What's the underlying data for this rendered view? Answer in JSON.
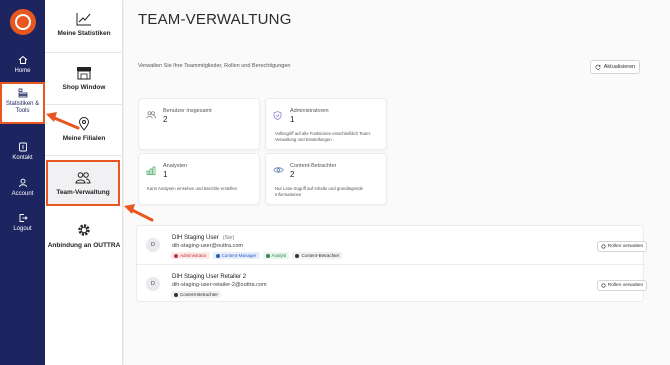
{
  "rail": {
    "items": [
      {
        "label": "Home",
        "icon": "home-icon"
      },
      {
        "label": "Statistiken & Tools",
        "icon": "chart-tools-icon"
      },
      {
        "label": "Kontakt",
        "icon": "contact-icon"
      },
      {
        "label": "Account",
        "icon": "user-icon"
      },
      {
        "label": "Logout",
        "icon": "logout-icon"
      }
    ]
  },
  "subnav": {
    "items": [
      {
        "label": "Meine Statistiken",
        "icon": "line-chart-icon"
      },
      {
        "label": "Shop Window",
        "icon": "storefront-icon"
      },
      {
        "label": "Meine Filialen",
        "icon": "map-pin-icon"
      },
      {
        "label": "Team-Verwaltung",
        "icon": "team-icon"
      },
      {
        "label": "Anbindung an OUTTRA",
        "icon": "gear-icon"
      }
    ]
  },
  "page": {
    "title": "TEAM-VERWALTUNG",
    "subtitle": "Verwalten Sie Ihre Teammitglieder, Rollen und Berechtigungen",
    "refresh_label": "Aktualisieren"
  },
  "cards": [
    {
      "label": "Benutzer insgesamt",
      "value": "2",
      "desc": "",
      "icon": "users-icon"
    },
    {
      "label": "Administratoren",
      "value": "1",
      "desc": "Vollzugriff auf alle Funktionen einschließlich Team-Verwaltung und Einstellungen",
      "icon": "shield-icon"
    },
    {
      "label": "Analysten",
      "value": "1",
      "desc": "Kann Analysen einsehen und Berichte erstellen",
      "icon": "bar-chart-icon"
    },
    {
      "label": "Content-Betrachter",
      "value": "2",
      "desc": "Nur Lese-Zugriff auf Inhalte und grundlegende Informationen",
      "icon": "eye-icon"
    }
  ],
  "users": [
    {
      "initial": "D",
      "name": "DIH Staging User",
      "you": "(Sie)",
      "email": "dih-staging-user@outtra.com",
      "tags": [
        "Administrator",
        "Content-Manager",
        "Analyst",
        "Content-Betrachter"
      ],
      "manage_label": "Rollen verwalten"
    },
    {
      "initial": "D",
      "name": "DIH Staging User Retailer 2",
      "you": "",
      "email": "dih-staging-user-retailer-2@outtra.com",
      "tags": [
        "Content-Betrachter"
      ],
      "manage_label": "Rollen verwalten"
    }
  ],
  "colors": {
    "brand": "#e8571f",
    "rail": "#1c2560"
  }
}
